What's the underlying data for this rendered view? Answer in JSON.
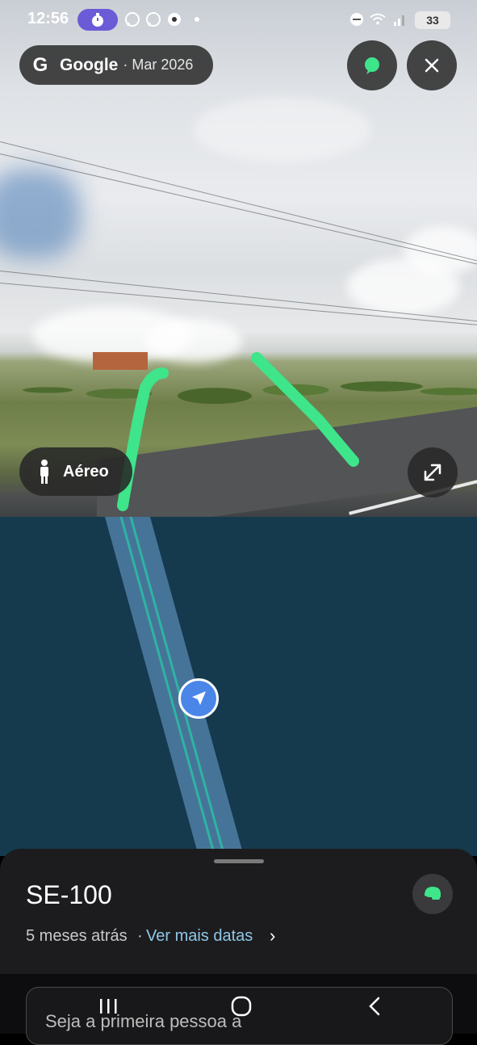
{
  "status_bar": {
    "time": "12:56",
    "battery": "33",
    "icons": [
      "timer-icon",
      "whatsapp-icon",
      "whatsapp-icon",
      "soccer-ball-icon",
      "dot-icon",
      "do-not-disturb-icon",
      "wifi-icon",
      "signal-icon",
      "battery-icon"
    ]
  },
  "header": {
    "provider": "Google",
    "date": "· Mar 2026"
  },
  "photo_controls": {
    "aereo_label": "Aéreo"
  },
  "sheet": {
    "title": "SE-100",
    "ago": "5 meses atrás",
    "separator": "·",
    "more_dates": "Ver mais datas",
    "chevron": "›"
  },
  "comment": {
    "placeholder": "Seja a primeira pessoa a"
  },
  "colors": {
    "accent_green": "#3ee58a",
    "map_bg": "#153a4d",
    "road_fill": "#4f7fa6",
    "road_line": "#2fb3a3",
    "link": "#8fc7e6",
    "nav_blue": "#4a86e8"
  }
}
